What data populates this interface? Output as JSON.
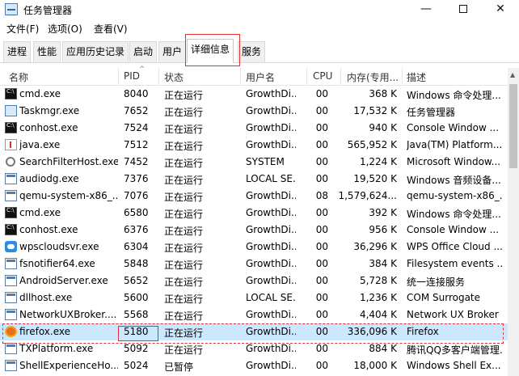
{
  "window": {
    "title": "任务管理器",
    "minimize": "—",
    "close": "✕"
  },
  "menu": [
    "文件(F)",
    "选项(O)",
    "查看(V)"
  ],
  "tabs": [
    "进程",
    "性能",
    "应用历史记录",
    "启动",
    "用户",
    "详细信息",
    "服务"
  ],
  "active_tab": "详细信息",
  "columns": [
    "名称",
    "PID",
    "状态",
    "用户名",
    "CPU",
    "内存(专用...",
    "描述"
  ],
  "sort_indicator": "^",
  "rows": [
    {
      "name": "cmd.exe",
      "pid": "8040",
      "status": "正在运行",
      "user": "GrowthDi...",
      "cpu": "00",
      "mem": "368 K",
      "desc": "Windows 命令处理...",
      "icon": "console-icon"
    },
    {
      "name": "Taskmgr.exe",
      "pid": "7652",
      "status": "正在运行",
      "user": "GrowthDi...",
      "cpu": "00",
      "mem": "17,532 K",
      "desc": "任务管理器",
      "icon": "task-manager-icon"
    },
    {
      "name": "conhost.exe",
      "pid": "7524",
      "status": "正在运行",
      "user": "GrowthDi...",
      "cpu": "00",
      "mem": "940 K",
      "desc": "Console Window ...",
      "icon": "console-icon"
    },
    {
      "name": "java.exe",
      "pid": "7512",
      "status": "正在运行",
      "user": "GrowthDi...",
      "cpu": "00",
      "mem": "565,952 K",
      "desc": "Java(TM) Platform...",
      "icon": "java-icon"
    },
    {
      "name": "SearchFilterHost.exe",
      "pid": "7452",
      "status": "正在运行",
      "user": "SYSTEM",
      "cpu": "00",
      "mem": "1,224 K",
      "desc": "Microsoft Window...",
      "icon": "search-icon"
    },
    {
      "name": "audiodg.exe",
      "pid": "7376",
      "status": "正在运行",
      "user": "LOCAL SE...",
      "cpu": "00",
      "mem": "19,520 K",
      "desc": "Windows 音频设备...",
      "icon": "window-icon"
    },
    {
      "name": "qemu-system-x86_...",
      "pid": "7076",
      "status": "正在运行",
      "user": "GrowthDi...",
      "cpu": "08",
      "mem": "1,579,624...",
      "desc": "qemu-system-x86_...",
      "icon": "window-icon"
    },
    {
      "name": "cmd.exe",
      "pid": "6580",
      "status": "正在运行",
      "user": "GrowthDi...",
      "cpu": "00",
      "mem": "392 K",
      "desc": "Windows 命令处理...",
      "icon": "console-icon"
    },
    {
      "name": "conhost.exe",
      "pid": "6376",
      "status": "正在运行",
      "user": "GrowthDi...",
      "cpu": "00",
      "mem": "956 K",
      "desc": "Console Window ...",
      "icon": "console-icon"
    },
    {
      "name": "wpscloudsvr.exe",
      "pid": "6304",
      "status": "正在运行",
      "user": "GrowthDi...",
      "cpu": "00",
      "mem": "36,296 K",
      "desc": "WPS Office Cloud ...",
      "icon": "wps-cloud-icon"
    },
    {
      "name": "fsnotifier64.exe",
      "pid": "5848",
      "status": "正在运行",
      "user": "GrowthDi...",
      "cpu": "00",
      "mem": "384 K",
      "desc": "Filesystem events ...",
      "icon": "window-icon"
    },
    {
      "name": "AndroidServer.exe",
      "pid": "5652",
      "status": "正在运行",
      "user": "GrowthDi...",
      "cpu": "00",
      "mem": "5,728 K",
      "desc": "统一连接服务",
      "icon": "window-icon"
    },
    {
      "name": "dllhost.exe",
      "pid": "5600",
      "status": "正在运行",
      "user": "LOCAL SE...",
      "cpu": "00",
      "mem": "1,236 K",
      "desc": "COM Surrogate",
      "icon": "window-icon"
    },
    {
      "name": "NetworkUXBroker....",
      "pid": "5568",
      "status": "正在运行",
      "user": "GrowthDi...",
      "cpu": "00",
      "mem": "4,404 K",
      "desc": "Network UX Broker",
      "icon": "window-icon"
    },
    {
      "name": "firefox.exe",
      "pid": "5180",
      "status": "正在运行",
      "user": "GrowthDi...",
      "cpu": "00",
      "mem": "336,096 K",
      "desc": "Firefox",
      "icon": "firefox-icon",
      "selected": true
    },
    {
      "name": "TXPlatform.exe",
      "pid": "5092",
      "status": "正在运行",
      "user": "GrowthDi...",
      "cpu": "00",
      "mem": "884 K",
      "desc": "腾讯QQ多客户端管理...",
      "icon": "window-icon"
    },
    {
      "name": "ShellExperienceHo...",
      "pid": "5024",
      "status": "已暂停",
      "user": "GrowthDi...",
      "cpu": "00",
      "mem": "18,000 K",
      "desc": "Windows Shell Ex...",
      "icon": "window-icon"
    }
  ]
}
